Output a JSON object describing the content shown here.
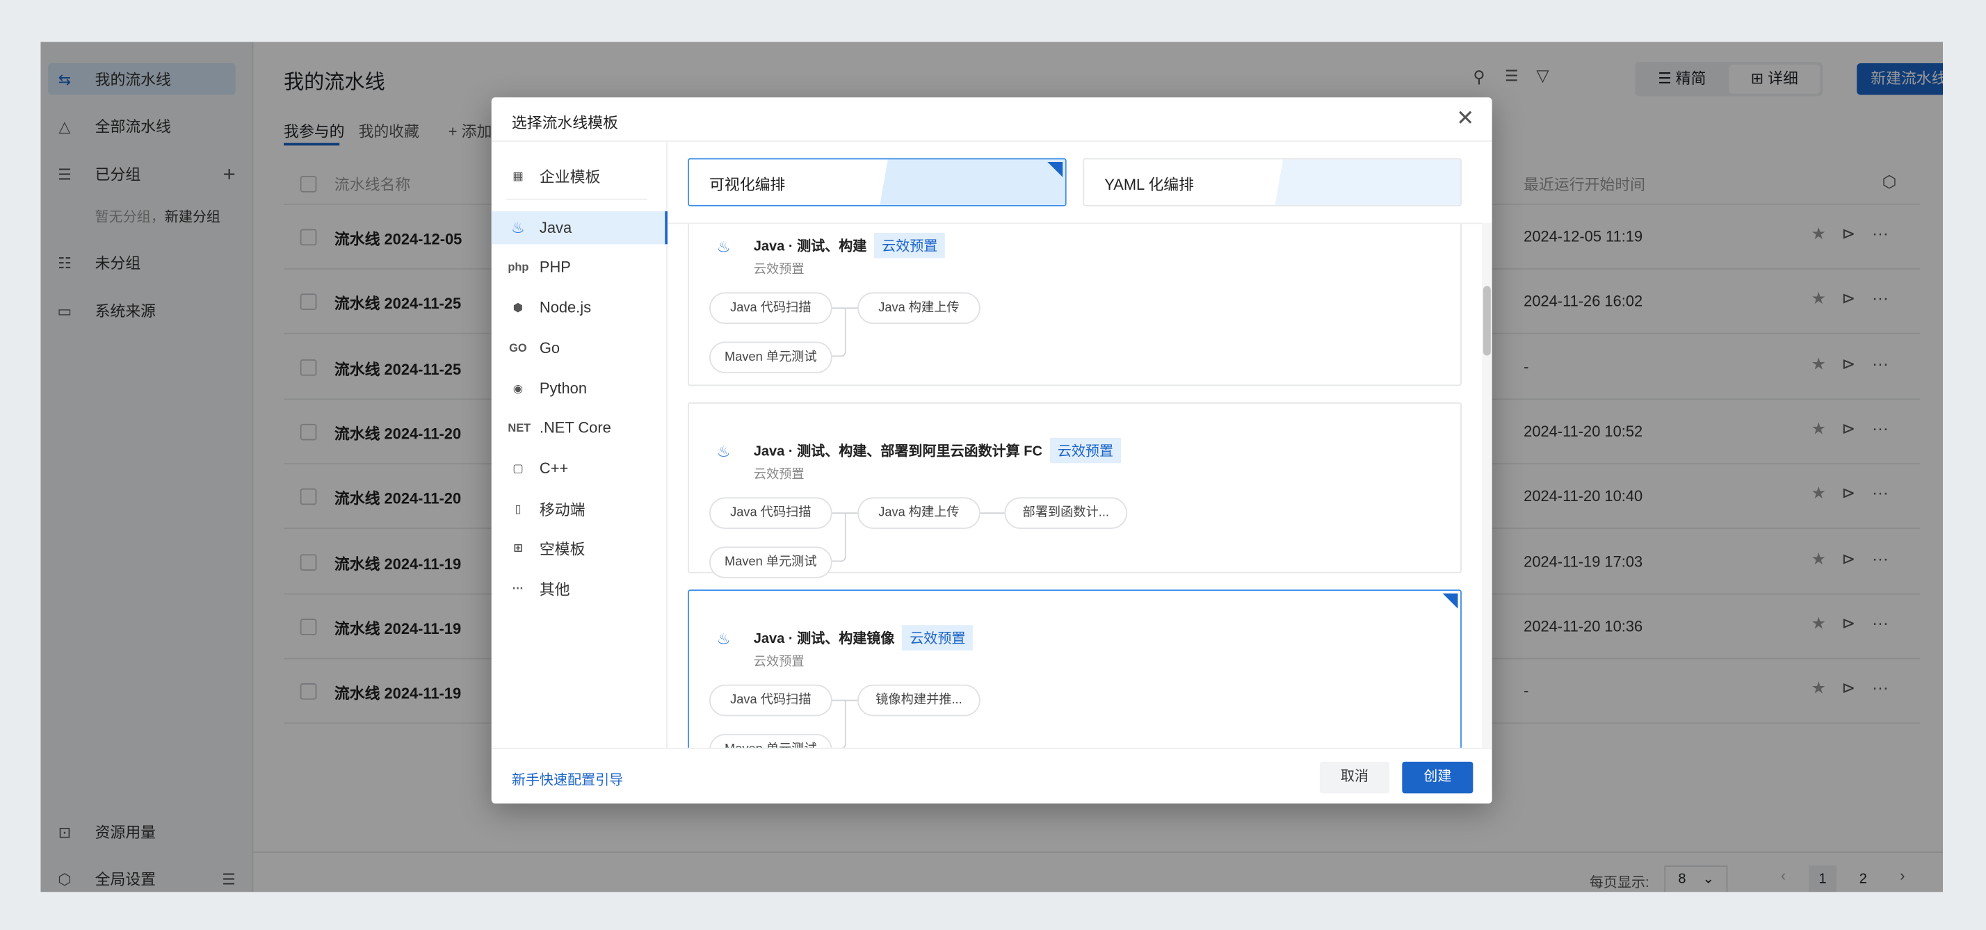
{
  "colors": {
    "accent": "#1b64c8",
    "background": "#e8ecef",
    "badge_bg": "#e1eefb"
  },
  "sidebar": {
    "items": [
      {
        "label": "我的流水线",
        "icon": "pipeline-icon",
        "active": true
      },
      {
        "label": "全部流水线",
        "icon": "flask-icon"
      },
      {
        "label": "已分组",
        "icon": "group-list-icon"
      },
      {
        "label": "未分组",
        "icon": "ungrouped-icon"
      },
      {
        "label": "系统来源",
        "icon": "monitor-icon"
      }
    ],
    "group_empty": "暂无分组，",
    "group_create": "新建分组",
    "bottom": [
      {
        "label": "资源用量",
        "icon": "inbox-icon"
      },
      {
        "label": "全局设置",
        "icon": "settings-icon"
      }
    ]
  },
  "header": {
    "title": "我的流水线",
    "new_button": "新建流水线",
    "view_compact": "精简",
    "view_detail": "详细"
  },
  "tabs": [
    {
      "label": "我参与的",
      "active": true
    },
    {
      "label": "我的收藏"
    },
    {
      "label": "添加"
    }
  ],
  "table": {
    "col_name": "流水线名称",
    "col_time": "最近运行开始时间",
    "rows": [
      {
        "name": "流水线 2024-12-05",
        "time": "2024-12-05 11:19"
      },
      {
        "name": "流水线 2024-11-25",
        "time": "2024-11-26 16:02"
      },
      {
        "name": "流水线 2024-11-25",
        "time": "-"
      },
      {
        "name": "流水线 2024-11-20",
        "time": "2024-11-20 10:52"
      },
      {
        "name": "流水线 2024-11-20",
        "time": "2024-11-20 10:40"
      },
      {
        "name": "流水线 2024-11-19",
        "time": "2024-11-19 17:03"
      },
      {
        "name": "流水线 2024-11-19",
        "time": "2024-11-20 10:36"
      },
      {
        "name": "流水线 2024-11-19",
        "time": "-"
      }
    ]
  },
  "pagination": {
    "per_page_label": "每页显示:",
    "per_page": "8",
    "pages": [
      "1",
      "2"
    ],
    "current": "1"
  },
  "modal": {
    "title": "选择流水线模板",
    "menu": [
      {
        "label": "企业模板",
        "icon": "grid-icon",
        "glyph": "▦"
      },
      {
        "label": "Java",
        "icon": "java-icon",
        "glyph": "♨",
        "active": true
      },
      {
        "label": "PHP",
        "icon": "php-icon",
        "glyph": "php"
      },
      {
        "label": "Node.js",
        "icon": "nodejs-icon",
        "glyph": "⬢"
      },
      {
        "label": "Go",
        "icon": "go-icon",
        "glyph": "GO"
      },
      {
        "label": "Python",
        "icon": "python-icon",
        "glyph": "◉"
      },
      {
        "label": ".NET Core",
        "icon": "dotnet-icon",
        "glyph": "NET"
      },
      {
        "label": "C++",
        "icon": "cpp-icon",
        "glyph": "▢"
      },
      {
        "label": "移动端",
        "icon": "mobile-icon",
        "glyph": "▯"
      },
      {
        "label": "空模板",
        "icon": "blank-template-icon",
        "glyph": "⊞"
      },
      {
        "label": "其他",
        "icon": "more-icon",
        "glyph": "···"
      }
    ],
    "modes": [
      {
        "label": "可视化编排",
        "selected": true
      },
      {
        "label": "YAML 化编排"
      }
    ],
    "templates": [
      {
        "title": "Java · 测试、构建",
        "badge": "云效预置",
        "sub": "云效预置",
        "stages": [
          "Java 代码扫描",
          "Maven 单元测试",
          "Java 构建上传"
        ]
      },
      {
        "title": "Java · 测试、构建、部署到阿里云函数计算 FC",
        "badge": "云效预置",
        "sub": "云效预置",
        "stages": [
          "Java 代码扫描",
          "Maven 单元测试",
          "Java 构建上传",
          "部署到函数计..."
        ]
      },
      {
        "title": "Java · 测试、构建镜像",
        "badge": "云效预置",
        "sub": "云效预置",
        "stages": [
          "Java 代码扫描",
          "Maven 单元测试",
          "镜像构建并推..."
        ],
        "selected": true
      }
    ],
    "guide_link": "新手快速配置引导",
    "cancel": "取消",
    "create": "创建"
  }
}
